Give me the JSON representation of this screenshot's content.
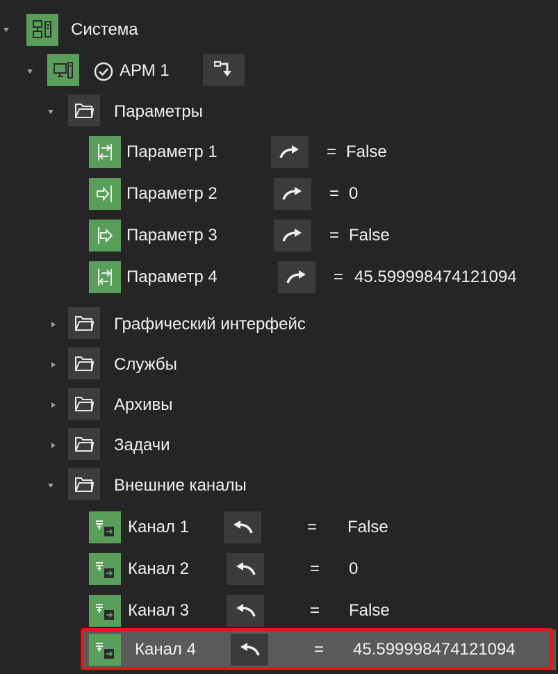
{
  "colors": {
    "background": "#252526",
    "green_icon": "#5a9e5c",
    "folder_bg": "#3c3c3c",
    "selection_border": "#e8141a",
    "selection_bg": "#5a5a5a"
  },
  "tree": {
    "root": {
      "label": "Система",
      "icon": "network-system-icon",
      "expanded": true
    },
    "workstation": {
      "label": "АРМ 1",
      "icon": "computer-icon",
      "status_icon": "check-circle-icon",
      "action_icon": "deploy-icon",
      "expanded": true
    },
    "folders": {
      "parameters": {
        "label": "Параметры",
        "expanded": true
      },
      "gui": {
        "label": "Графический интерфейс",
        "expanded": false
      },
      "services": {
        "label": "Службы",
        "expanded": false
      },
      "archives": {
        "label": "Архивы",
        "expanded": false
      },
      "tasks": {
        "label": "Задачи",
        "expanded": false
      },
      "external": {
        "label": "Внешние каналы",
        "expanded": true
      }
    },
    "parameters": [
      {
        "label": "Параметр 1",
        "icon": "bidirectional-param-icon",
        "eq": "=",
        "value": "False"
      },
      {
        "label": "Параметр 2",
        "icon": "input-param-icon",
        "eq": "=",
        "value": "0"
      },
      {
        "label": "Параметр 3",
        "icon": "output-param-icon",
        "eq": "=",
        "value": "False"
      },
      {
        "label": "Параметр 4",
        "icon": "bidirectional-param-icon",
        "eq": "=",
        "value": "45.599998474121094"
      }
    ],
    "channels": [
      {
        "label": "Канал 1",
        "eq": "=",
        "value": "False"
      },
      {
        "label": "Канал 2",
        "eq": "=",
        "value": "0"
      },
      {
        "label": "Канал 3",
        "eq": "=",
        "value": "False"
      },
      {
        "label": "Канал 4",
        "eq": "=",
        "value": "45.599998474121094",
        "selected": true
      }
    ]
  }
}
